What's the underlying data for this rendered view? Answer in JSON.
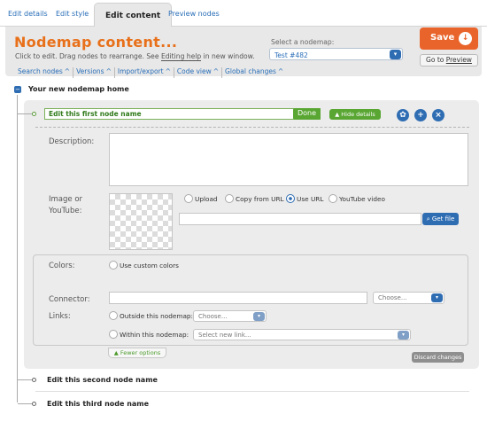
{
  "tabs": [
    "Edit details",
    "Edit style",
    "Edit content",
    "Preview nodes"
  ],
  "header": {
    "title": "Nodemap content...",
    "instr_before": "Click to edit. Drag nodes to rearrange. See ",
    "instr_link": "Editing help",
    "instr_after": " in new window.",
    "select_label": "Select a nodemap:",
    "select_value": "Test #482",
    "save_label": "Save",
    "goto_before": "Go to ",
    "goto_link": "Preview"
  },
  "subtabs": [
    "Search nodes",
    "Versions",
    "Import/export",
    "Code view",
    "Global changes"
  ],
  "tree": {
    "home": "Your new nodemap home",
    "node1_name": "Edit this first node name",
    "done": "Done",
    "hide_details": "Hide details",
    "node2": "Edit this second node name",
    "node3": "Edit this third node name"
  },
  "form": {
    "description_label": "Description:",
    "image_label_1": "Image or",
    "image_label_2": "YouTube:",
    "upload": "Upload",
    "copy_url": "Copy from URL",
    "use_url": "Use URL",
    "youtube": "YouTube video",
    "get_file": "Get file",
    "colors_label": "Colors:",
    "custom_colors": "Use custom colors",
    "connector_label": "Connector:",
    "connector_select": "Choose...",
    "links_label": "Links:",
    "outside": "Outside this nodemap:",
    "outside_select": "Choose...",
    "within": "Within this nodemap:",
    "within_select": "Select new link...",
    "fewer_options": "Fewer options",
    "discard": "Discard changes"
  },
  "colors": {
    "accent_orange": "#e9642b",
    "link_blue": "#2a6fb8",
    "green": "#59a633"
  }
}
